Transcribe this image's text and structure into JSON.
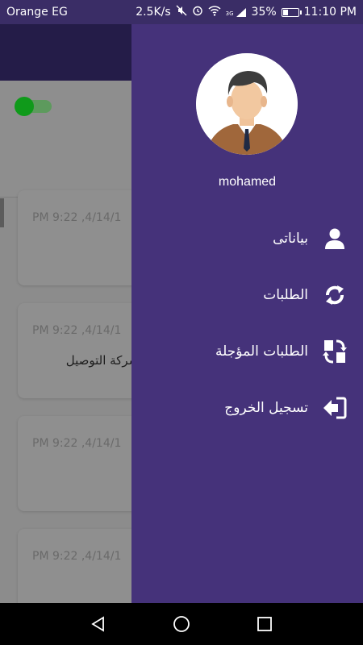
{
  "status_bar": {
    "carrier": "Orange EG",
    "speed": "2.5K/s",
    "network_tag": "3G",
    "battery_percent": "35%",
    "battery_level": 0.35,
    "time": "11:10 PM"
  },
  "background_app": {
    "toggle_on": true,
    "cards": [
      {
        "date": "PM 9:22 ,4/14/1",
        "text": ""
      },
      {
        "date": "PM 9:22 ,4/14/1",
        "text": "ن شركة التوصيل"
      },
      {
        "date": "PM 9:22 ,4/14/1",
        "text": ""
      },
      {
        "date": "PM 9:22 ,4/14/1",
        "text": ""
      }
    ]
  },
  "drawer": {
    "username": "mohamed",
    "items": [
      {
        "label": "بياناتى",
        "icon": "user-icon"
      },
      {
        "label": "الطلبات",
        "icon": "refresh-icon"
      },
      {
        "label": "الطلبات المؤجلة",
        "icon": "postponed-orders-icon"
      },
      {
        "label": "تسجيل الخروج",
        "icon": "logout-icon"
      }
    ]
  },
  "nav_bar": {
    "buttons": [
      "back-icon",
      "home-icon",
      "recents-icon"
    ]
  },
  "colors": {
    "drawer_bg": "#45327a",
    "status_bar_bg": "#3a2d66",
    "toggle_green": "#0f9a1a"
  }
}
